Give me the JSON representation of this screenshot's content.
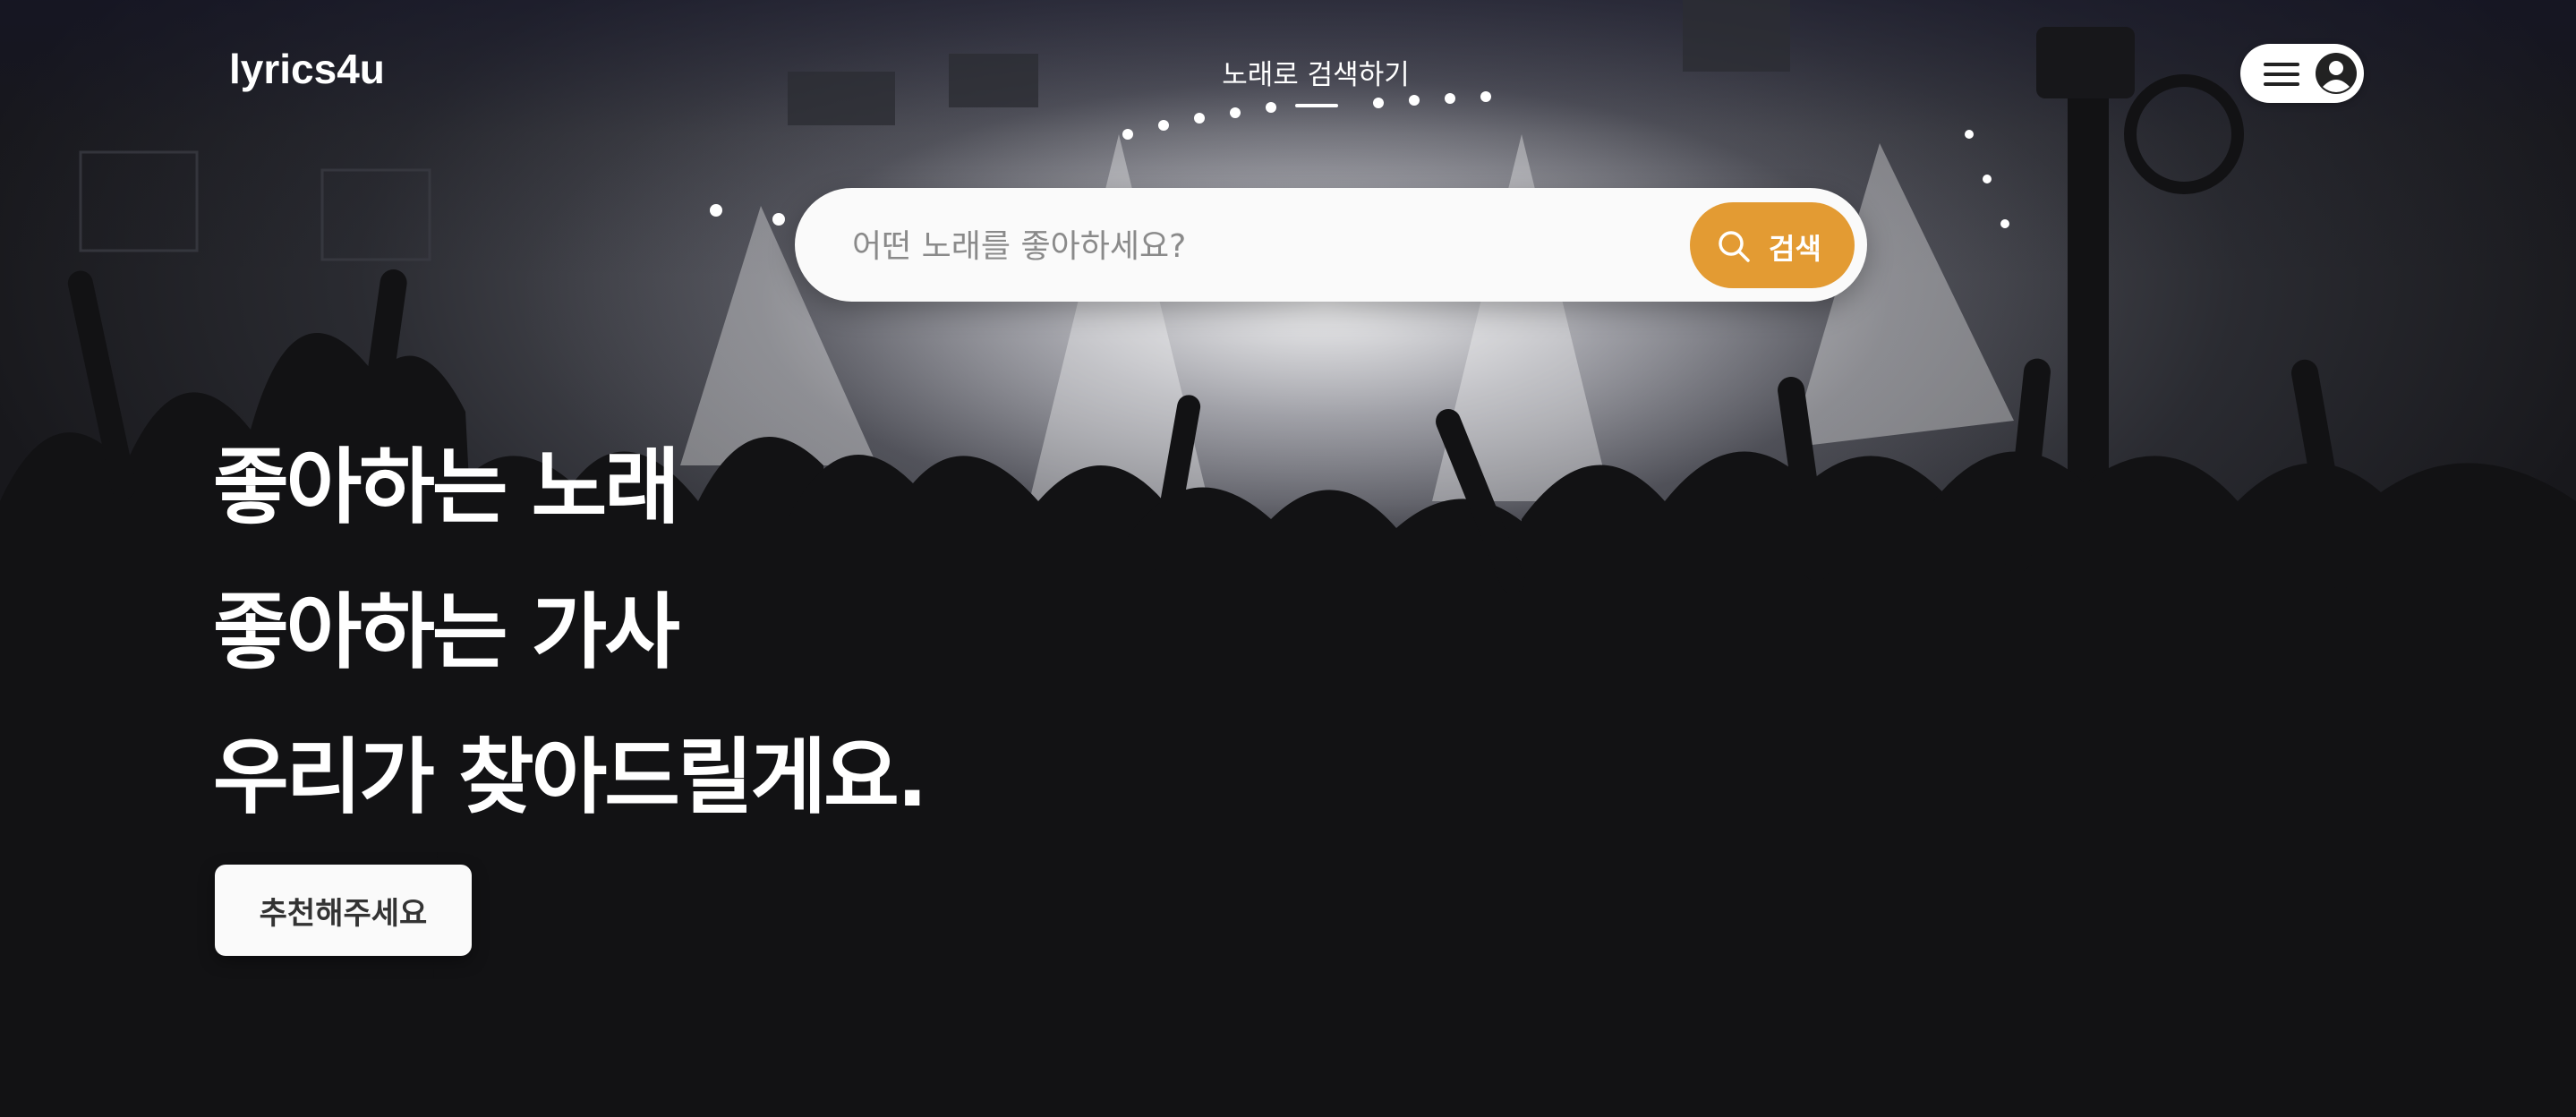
{
  "header": {
    "logo": "lyrics4u",
    "nav_link": "노래로 검색하기"
  },
  "search": {
    "placeholder": "어떤 노래를 좋아하세요?",
    "value": "",
    "button_label": "검색"
  },
  "hero": {
    "headline_lines": [
      "좋아하는 노래",
      "좋아하는 가사",
      "우리가 찾아드릴게요."
    ],
    "recommend_button": "추천해주세요"
  },
  "icons": {
    "menu": "hamburger-icon",
    "profile": "profile-icon",
    "search": "search-icon"
  },
  "colors": {
    "accent": "#e39b33",
    "text": "#ffffff"
  }
}
